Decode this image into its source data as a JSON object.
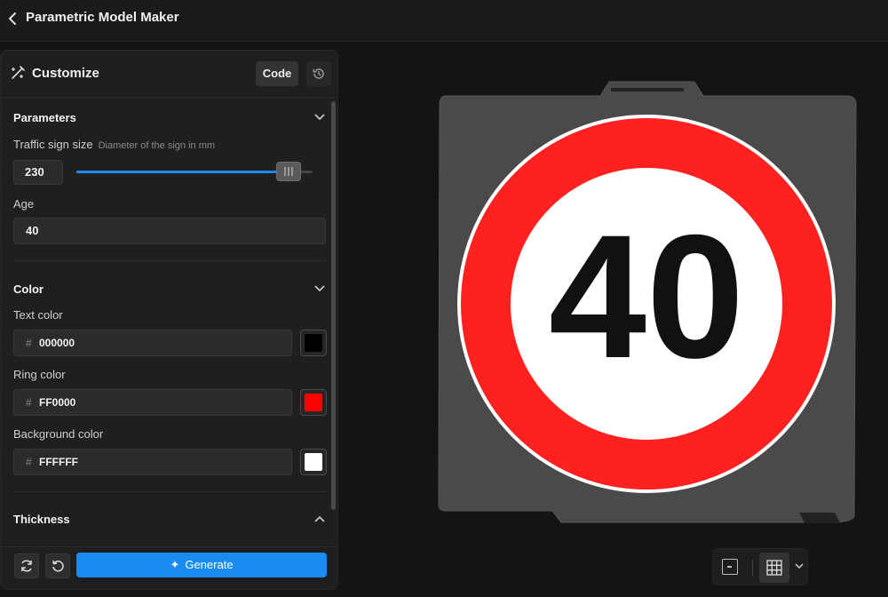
{
  "app": {
    "title": "Parametric Model Maker"
  },
  "panel": {
    "title": "Customize",
    "code_label": "Code"
  },
  "parameters": {
    "section_title": "Parameters",
    "size": {
      "label": "Traffic sign size",
      "description": "Diameter of the sign in mm",
      "value": "230",
      "slider_fraction": 0.9
    },
    "age": {
      "label": "Age",
      "value": "40"
    }
  },
  "color": {
    "section_title": "Color",
    "items": [
      {
        "label": "Text color",
        "hash": "#",
        "value": "000000",
        "swatch": "#000000"
      },
      {
        "label": "Ring color",
        "hash": "#",
        "value": "FF0000",
        "swatch": "#FF0000"
      },
      {
        "label": "Background color",
        "hash": "#",
        "value": "FFFFFF",
        "swatch": "#FFFFFF"
      }
    ]
  },
  "thickness": {
    "section_title": "Thickness"
  },
  "actions": {
    "generate_label": "Generate"
  },
  "viewer": {
    "sign_text": "40",
    "ring_color": "#FF2020",
    "plate_color": "#4a4a4a"
  }
}
